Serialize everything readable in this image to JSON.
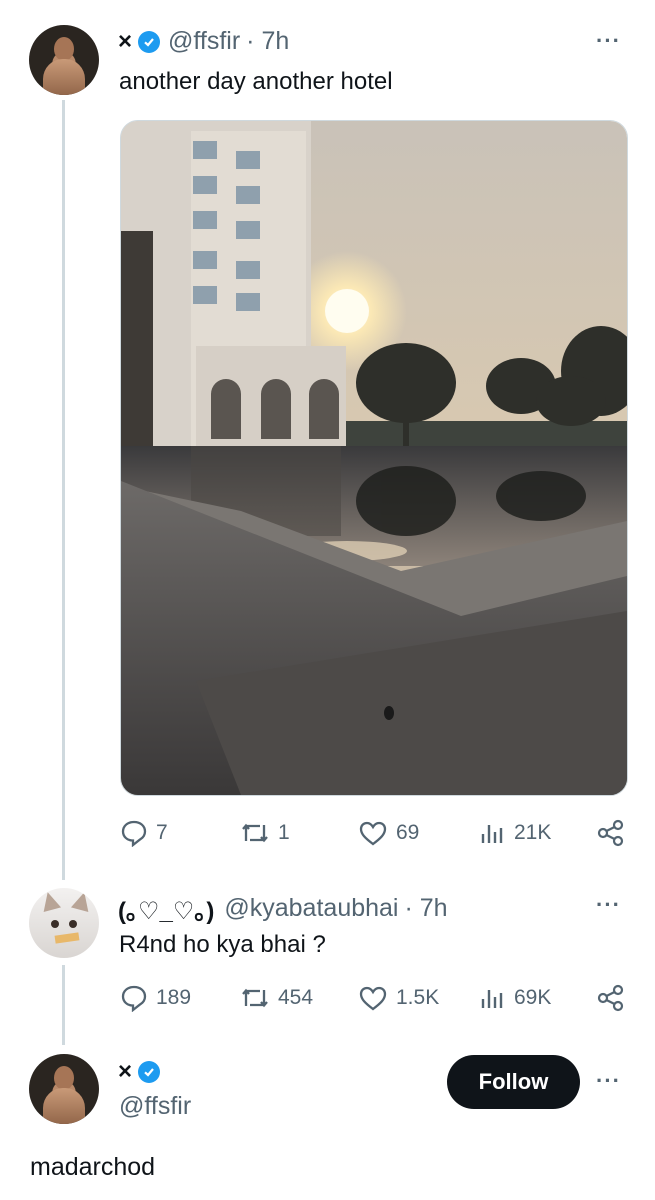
{
  "tweets": [
    {
      "display_name": "×",
      "handle": "@ffsfir",
      "time": "· 7h",
      "text": "another day another hotel",
      "stats": {
        "replies": "7",
        "reposts": "1",
        "likes": "69",
        "views": "21K"
      }
    },
    {
      "display_name": "(｡♡_♡｡)",
      "handle": "@kyabataubhai",
      "time": "· 7h",
      "text": "R4nd ho kya bhai ?",
      "stats": {
        "replies": "189",
        "reposts": "454",
        "likes": "1.5K",
        "views": "69K"
      }
    }
  ],
  "profile": {
    "display_name": "×",
    "handle": "@ffsfir",
    "follow_label": "Follow",
    "text": "madarchod"
  },
  "more_label": "···",
  "colors": {
    "verified": "#1d9bf0",
    "text_secondary": "#536471",
    "follow_bg": "#0f1419"
  }
}
